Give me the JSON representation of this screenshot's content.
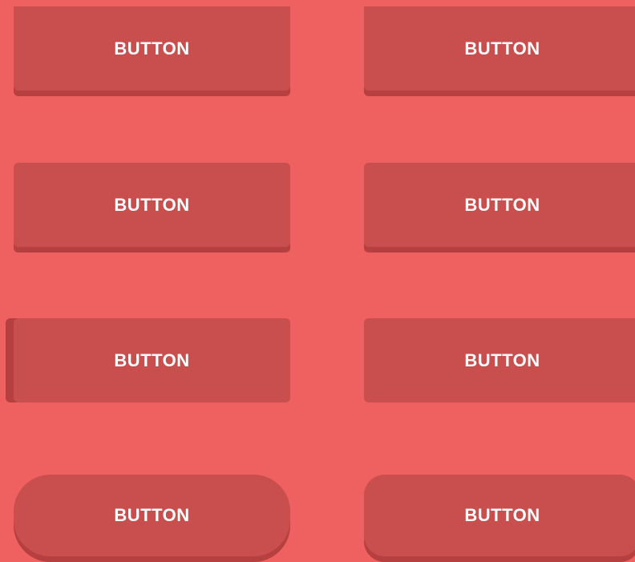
{
  "theme": {
    "background": "#ef6060",
    "button_color": "#c94e4e",
    "shadow_color": "#b63f40",
    "text_color": "#ffffff"
  },
  "buttons": {
    "r1_left": "BUTTON",
    "r1_right": "BUTTON",
    "r2_left": "BUTTON",
    "r2_right": "BUTTON",
    "r3_left": "BUTTON",
    "r3_right": "BUTTON",
    "r4_left": "BUTTON",
    "r4_right": "BUTTON"
  }
}
